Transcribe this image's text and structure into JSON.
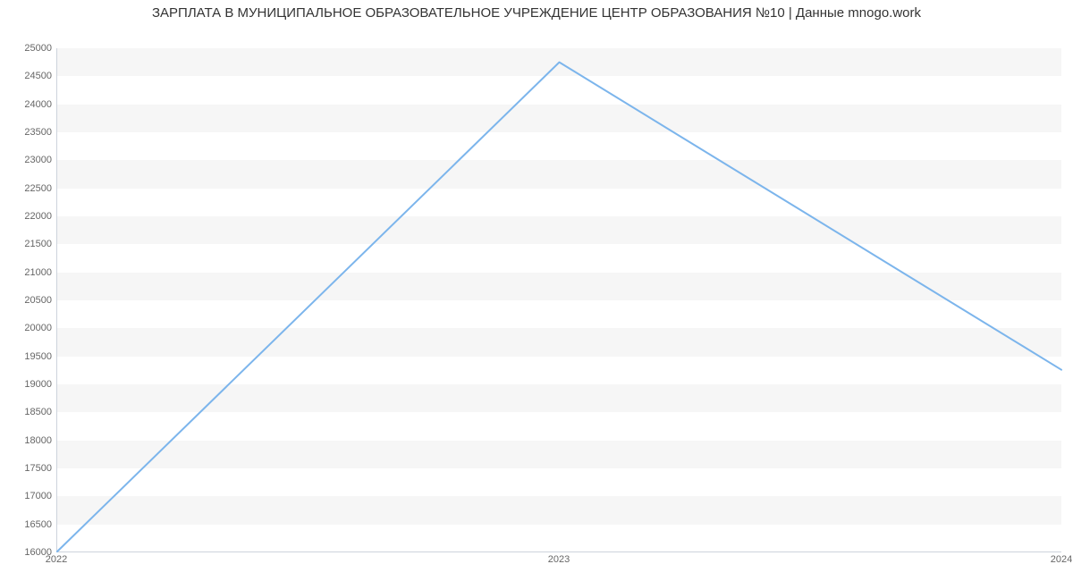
{
  "chart_data": {
    "type": "line",
    "title": "ЗАРПЛАТА В МУНИЦИПАЛЬНОЕ ОБРАЗОВАТЕЛЬНОЕ УЧРЕЖДЕНИЕ ЦЕНТР ОБРАЗОВАНИЯ №10 | Данные mnogo.work",
    "x": [
      2022,
      2023,
      2024
    ],
    "values": [
      16000,
      24750,
      19250
    ],
    "xticks": [
      2022,
      2023,
      2024
    ],
    "yticks": [
      16000,
      16500,
      17000,
      17500,
      18000,
      18500,
      19000,
      19500,
      20000,
      20500,
      21000,
      21500,
      22000,
      22500,
      23000,
      23500,
      24000,
      24500,
      25000
    ],
    "ylim": [
      16000,
      25000
    ],
    "xlim": [
      2022,
      2024
    ],
    "series_color": "#7cb5ec",
    "xlabel": "",
    "ylabel": ""
  }
}
